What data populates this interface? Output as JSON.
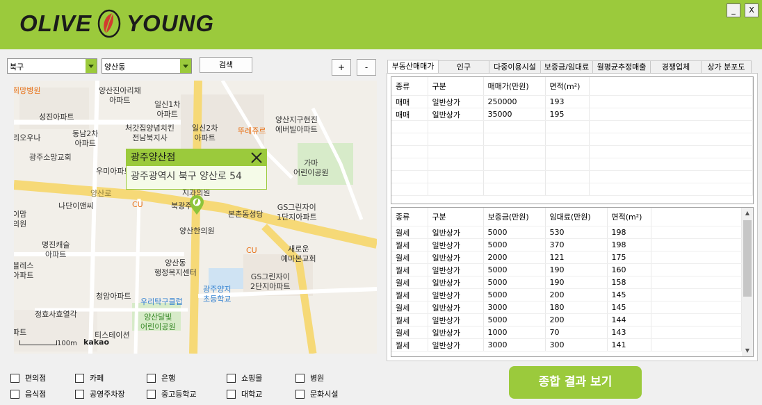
{
  "app": {
    "brand": "OLIVE YOUNG",
    "brand_left": "OLIVE",
    "brand_right": "YOUNG",
    "minimize_label": "_",
    "close_label": "X"
  },
  "search": {
    "district": "북구",
    "dong": "양산동",
    "search_button": "검색",
    "zoom_in": "+",
    "zoom_out": "-"
  },
  "map": {
    "popup_title": "광주양산점",
    "popup_address": "광주광역시 북구 양산로 54",
    "scale_label": "100m",
    "provider": "kakao",
    "pois": [
      "희망병원",
      "양산진아리채\n아파트",
      "일신1차\n아파트",
      "성진아파트",
      "동남2차\n아파트",
      "처갓집양념치킨\n전남북지사",
      "일신2차\n아파트",
      "뚜레쥬르",
      "양산지구현진\n에버빌아파트",
      "리오우나",
      "광주소망교회",
      "우미아파트",
      "가마\n어린이공원",
      "나단이앤씨",
      "CU",
      "북광주",
      "본촌동성당",
      "GS그린자이\n1단지아파트",
      "양산한의원",
      "이맘\n의원",
      "명진캐슬\n아파트",
      "CU",
      "새로운\n예마본교회",
      "블레스\n아파트",
      "양산동\n행정복지센터",
      "GS그린자이\n2단지아파트",
      "청암아파트",
      "우리탁구클럽",
      "광주양지\n초등학교",
      "정효사효열각",
      "양산달빛\n어린이공원",
      "파트",
      "티스테이션",
      "지과의원",
      "양산로",
      "빌",
      "치과의원",
      "양산로"
    ]
  },
  "tabs": [
    "부동산매매가",
    "인구",
    "다중이용시설",
    "보증금/임대료",
    "월평균추정매출",
    "경쟁업체",
    "상가 분포도"
  ],
  "sale_table": {
    "headers": [
      "종류",
      "구분",
      "매매가(만원)",
      "면적(m²)"
    ],
    "rows": [
      [
        "매매",
        "일반상가",
        "250000",
        "193"
      ],
      [
        "매매",
        "일반상가",
        "35000",
        "195"
      ]
    ]
  },
  "rent_table": {
    "headers": [
      "종류",
      "구분",
      "보증금(만원)",
      "임대료(만원)",
      "면적(m²)"
    ],
    "rows": [
      [
        "월세",
        "일반상가",
        "5000",
        "530",
        "198"
      ],
      [
        "월세",
        "일반상가",
        "5000",
        "370",
        "198"
      ],
      [
        "월세",
        "일반상가",
        "2000",
        "121",
        "175"
      ],
      [
        "월세",
        "일반상가",
        "5000",
        "190",
        "160"
      ],
      [
        "월세",
        "일반상가",
        "5000",
        "190",
        "158"
      ],
      [
        "월세",
        "일반상가",
        "5000",
        "200",
        "145"
      ],
      [
        "월세",
        "일반상가",
        "3000",
        "180",
        "145"
      ],
      [
        "월세",
        "일반상가",
        "5000",
        "200",
        "144"
      ],
      [
        "월세",
        "일반상가",
        "1000",
        "70",
        "143"
      ],
      [
        "월세",
        "일반상가",
        "3000",
        "300",
        "141"
      ]
    ]
  },
  "filters": [
    "편의점",
    "카페",
    "은행",
    "쇼핑몰",
    "병원",
    "음식점",
    "공영주차장",
    "중고등학교",
    "대학교",
    "문화시설"
  ],
  "summary_button": "종합 결과 보기",
  "colors": {
    "accent": "#9bca3c",
    "header": "#9bca3c"
  }
}
